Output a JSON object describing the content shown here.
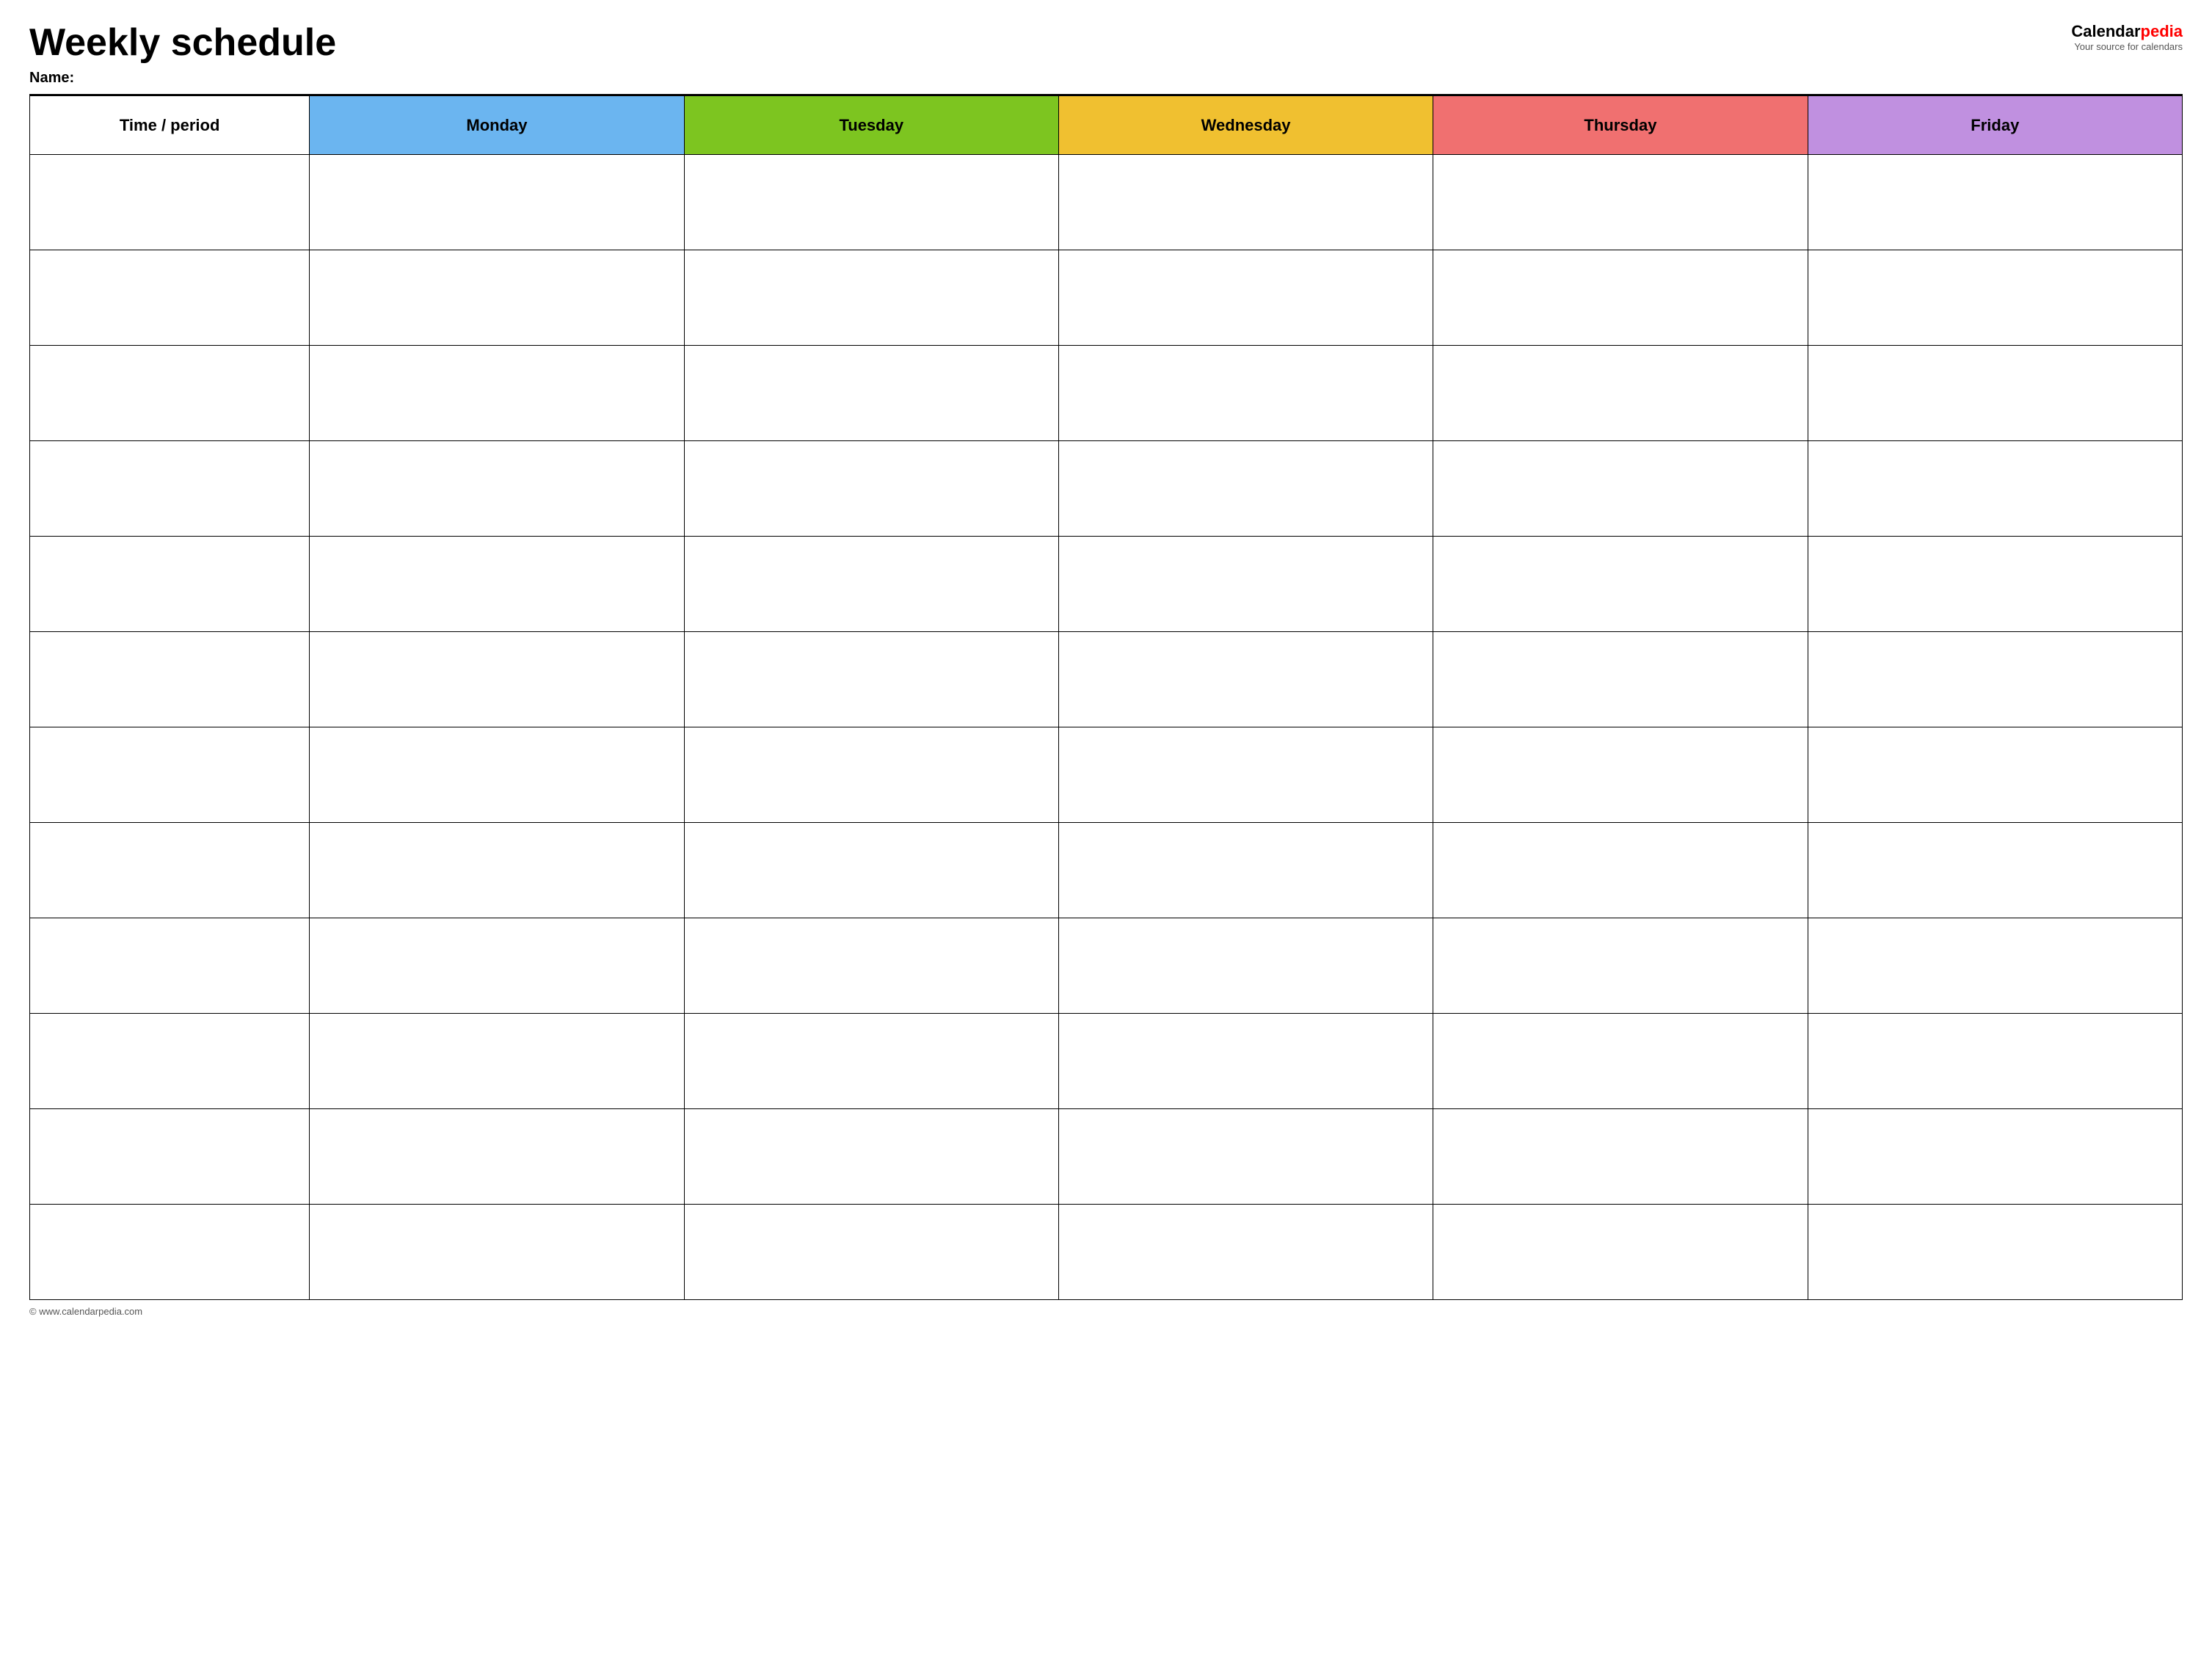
{
  "header": {
    "title": "Weekly schedule",
    "name_label": "Name:",
    "logo_calendar": "Calendar",
    "logo_pedia": "pedia",
    "logo_tagline": "Your source for calendars",
    "footer": "© www.calendarpedia.com"
  },
  "table": {
    "columns": [
      {
        "key": "time",
        "label": "Time / period",
        "class": "th-time"
      },
      {
        "key": "monday",
        "label": "Monday",
        "class": "th-monday"
      },
      {
        "key": "tuesday",
        "label": "Tuesday",
        "class": "th-tuesday"
      },
      {
        "key": "wednesday",
        "label": "Wednesday",
        "class": "th-wednesday"
      },
      {
        "key": "thursday",
        "label": "Thursday",
        "class": "th-thursday"
      },
      {
        "key": "friday",
        "label": "Friday",
        "class": "th-friday"
      }
    ],
    "row_count": 12
  }
}
